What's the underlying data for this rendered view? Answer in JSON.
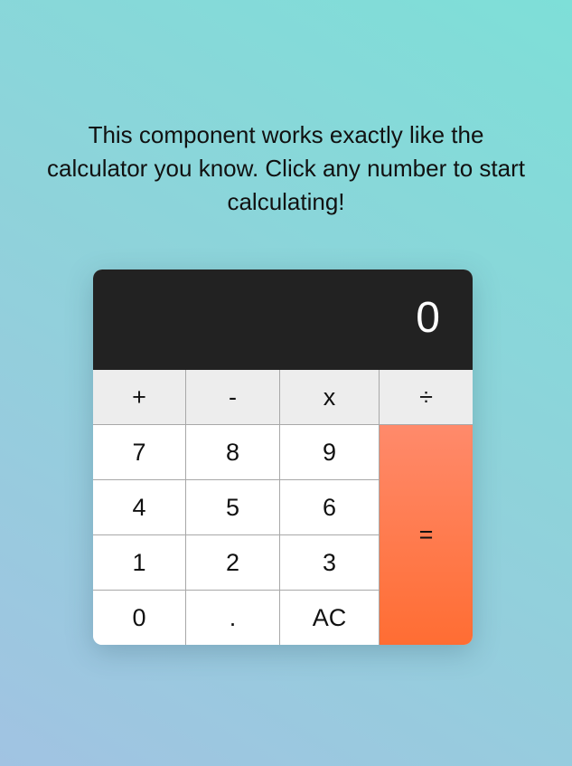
{
  "intro": {
    "text": "This component works exactly like the calculator you know. Click any number to start calculating!"
  },
  "calculator": {
    "display": "0",
    "operators": {
      "add": "+",
      "subtract": "-",
      "multiply": "x",
      "divide": "÷"
    },
    "digits": {
      "d7": "7",
      "d8": "8",
      "d9": "9",
      "d4": "4",
      "d5": "5",
      "d6": "6",
      "d1": "1",
      "d2": "2",
      "d3": "3",
      "d0": "0"
    },
    "decimal": ".",
    "clear": "AC",
    "equals": "="
  },
  "colors": {
    "display_bg": "#222222",
    "operator_bg": "#ededed",
    "equals_gradient_top": "#ff8a6b",
    "equals_gradient_bottom": "#ff6d33",
    "background_top": "#7edfd8",
    "background_bottom": "#a1c3e2"
  }
}
